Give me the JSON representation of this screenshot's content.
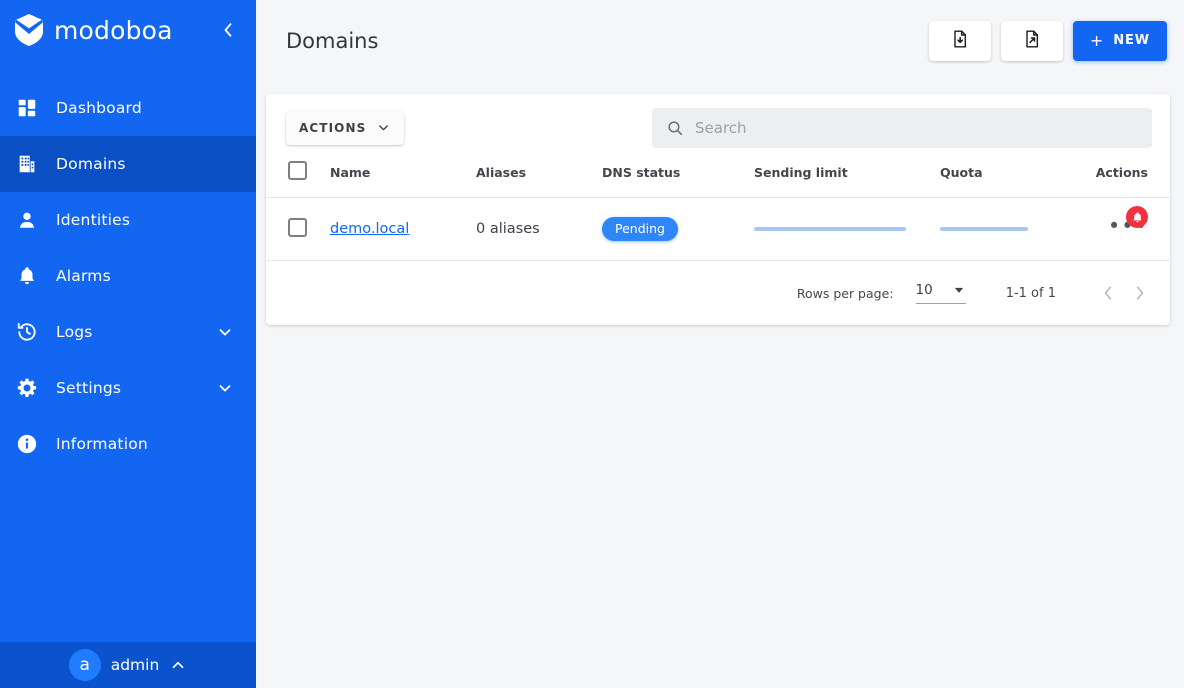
{
  "brand": {
    "name": "modoboa",
    "logo_icon": "modoboa-logo-icon",
    "collapse_icon": "chevron-left-icon"
  },
  "sidebar": {
    "items": [
      {
        "label": "Dashboard",
        "icon": "dashboard-grid-icon",
        "active": false,
        "expandable": false
      },
      {
        "label": "Domains",
        "icon": "building-icon",
        "active": true,
        "expandable": false
      },
      {
        "label": "Identities",
        "icon": "person-icon",
        "active": false,
        "expandable": false
      },
      {
        "label": "Alarms",
        "icon": "bell-icon",
        "active": false,
        "expandable": false
      },
      {
        "label": "Logs",
        "icon": "history-icon",
        "active": false,
        "expandable": true
      },
      {
        "label": "Settings",
        "icon": "gear-icon",
        "active": false,
        "expandable": true
      },
      {
        "label": "Information",
        "icon": "info-circle-icon",
        "active": false,
        "expandable": false
      }
    ],
    "user": {
      "avatar_letter": "a",
      "name": "admin",
      "chevron_icon": "chevron-up-icon"
    }
  },
  "header": {
    "title": "Domains",
    "import_icon": "file-import-icon",
    "export_icon": "file-export-icon",
    "new_label": "NEW",
    "new_plus": "+"
  },
  "toolbar": {
    "actions_label": "ACTIONS",
    "actions_chevron": "chevron-down-icon",
    "search_placeholder": "Search",
    "search_value": "",
    "search_icon": "search-icon"
  },
  "table": {
    "columns": [
      "Name",
      "Aliases",
      "DNS status",
      "Sending limit",
      "Quota",
      "Actions"
    ],
    "rows": [
      {
        "name": "demo.local",
        "aliases": "0 aliases",
        "dns_status": "Pending",
        "sending_limit_pct": 100,
        "quota_pct": 100,
        "actions_icon": "more-horizontal-icon",
        "alarm_icon": "bell-alert-icon"
      }
    ]
  },
  "pagination": {
    "rows_per_page_label": "Rows per page:",
    "rows_per_page_value": "10",
    "dropdown_icon": "triangle-down-icon",
    "range": "1-1 of 1",
    "prev_icon": "chevron-left-icon",
    "next_icon": "chevron-right-icon"
  },
  "colors": {
    "sidebar_blue": "#1266f1",
    "sidebar_active": "#0b4fc4",
    "accent": "#1266f1",
    "badge_blue": "#2f86f6",
    "alarm_red": "#f0313f",
    "progress_blue": "#aac5f5"
  }
}
